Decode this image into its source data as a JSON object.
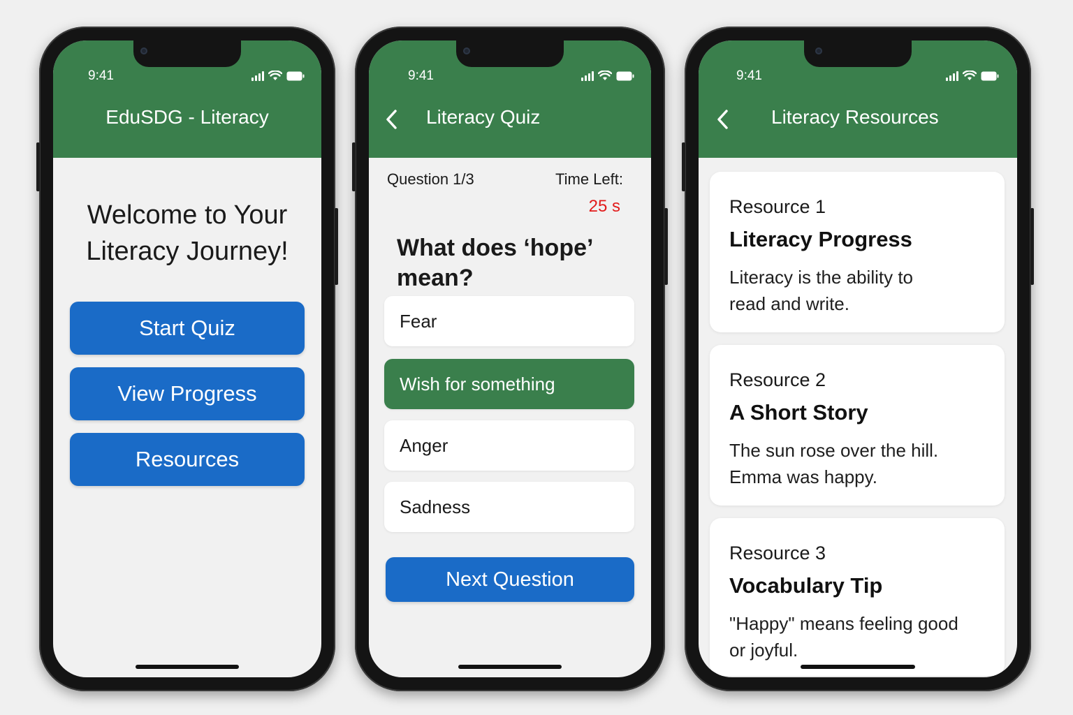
{
  "status_bar": {
    "time": "9:41"
  },
  "colors": {
    "header_green": "#3a7f4c",
    "button_blue": "#1a6bc7",
    "timer_red": "#e21b1b",
    "screen_bg": "#f1f1f1"
  },
  "home_screen": {
    "title": "EduSDG - Literacy",
    "welcome_line1": "Welcome to Your",
    "welcome_line2": "Literacy Journey!",
    "buttons": [
      "Start Quiz",
      "View Progress",
      "Resources"
    ]
  },
  "quiz_screen": {
    "title": "Literacy Quiz",
    "question_counter": "Question 1/3",
    "time_left_label": "Time Left:",
    "time_left_value": "25 s",
    "question_line1": "What does ‘hope’",
    "question_line2": "mean?",
    "options": [
      {
        "label": "Fear",
        "selected": false
      },
      {
        "label": "Wish for something",
        "selected": true
      },
      {
        "label": "Anger",
        "selected": false
      },
      {
        "label": "Sadness",
        "selected": false
      }
    ],
    "next_button": "Next Question"
  },
  "resources_screen": {
    "title": "Literacy Resources",
    "cards": [
      {
        "label": "Resource 1",
        "heading": "Literacy Progress",
        "body_line1": "Literacy is the ability to",
        "body_line2": "read and write."
      },
      {
        "label": "Resource 2",
        "heading": "A Short Story",
        "body_line1": "The sun rose over the hill.",
        "body_line2": "Emma was happy."
      },
      {
        "label": "Resource 3",
        "heading": "Vocabulary Tip",
        "body_line1": "\"Happy\" means feeling good",
        "body_line2": "or joyful."
      }
    ]
  }
}
